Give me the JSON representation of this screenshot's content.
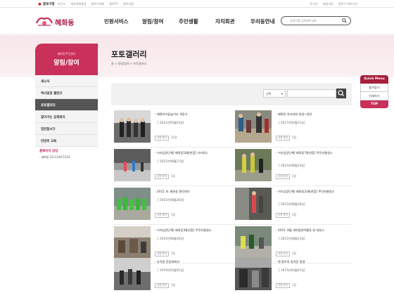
{
  "topbar": {
    "home": "종로구청",
    "links": [
      "보건소",
      "역사문화관광",
      "종로구의회",
      "종로TV",
      "종로사랑"
    ],
    "right": [
      "로그인",
      "회원가입",
      "종로구 바로가기"
    ]
  },
  "header": {
    "logo_text": "혜화동",
    "gnb": [
      "민원서비스",
      "알림/참여",
      "주민생활",
      "자치회관",
      "우리동안내"
    ],
    "search_placeholder": "검색어를 입력해주세요"
  },
  "sidebar": {
    "subtitle": "혜화동주민센터",
    "title": "알림/참여",
    "items": [
      {
        "label": "새소식"
      },
      {
        "label": "맥사일정 캘린더"
      },
      {
        "label": "포토갤러리"
      },
      {
        "label": "찾아가는 공제회의"
      },
      {
        "label": "칭찬합시다"
      },
      {
        "label": "민방위 교육"
      }
    ],
    "contact_title": "홈페이지 담당",
    "contact_detail": "- 혜화동 02-2148-5333"
  },
  "content": {
    "title": "포토갤러리",
    "breadcrumb": "홈 > 알림/참여 > 포토갤러리",
    "filter_select": "선택",
    "filter_arrow": "▾"
  },
  "gallery": [
    {
      "title": "- 혜명아이들놀이터 개장식",
      "date": "[ 2021년05월03일]",
      "badge": "사진 보기",
      "views": "12장"
    },
    {
      "title": "- 혜화동 척사대회 생생~현장",
      "date": "[ 2017년02월11일]",
      "badge": "사진 보기",
      "views": "1장"
    },
    {
      "title": "- 거리입양단체[ 혜화동18통연합] 거리청소",
      "date": "[ 2015년08월27일]",
      "badge": "사진 보기",
      "views": "1장"
    },
    {
      "title": "- 거리입양단체[ 혜화동7통연합] 주민자율청소",
      "date": "[ 2015년08월24일]",
      "badge": "사진 보기",
      "views": "1장"
    },
    {
      "title": "- 2015. 8. 혜화동 클린데이",
      "date": "[ 2015년08월26일]",
      "badge": "사진 보기",
      "views": "1장"
    },
    {
      "title": "- 거리입양단체[ 혜화동23통연합] 주민자율청소",
      "date": "[ 2015년08월26일]",
      "badge": "사진 보기",
      "views": "1장"
    },
    {
      "title": "- 거리입양단체[ 혜화동3통연합] 주민자율청소",
      "date": "[ 2015년08월26일]",
      "badge": "사진 보기",
      "views": "1장"
    },
    {
      "title": "- 2015. 8월 새마을방역활동 및 대청소",
      "date": "[ 2015년08월13일]",
      "badge": "사진 보기",
      "views": "1장"
    },
    {
      "title": "- 유치원 운동회에서",
      "date": "[ 1979년01월01일]",
      "badge": "사진 보기",
      "views": "1장"
    },
    {
      "title": "- 옛 종로의 정겨운 풍경",
      "date": "[ 1973년04월07일]",
      "badge": "사진 보기",
      "views": "1장"
    }
  ],
  "quick": {
    "head": "Quick Menu",
    "items": [
      "즐겨찾기",
      "인쇄하기"
    ],
    "top": "TOP"
  },
  "colors": {
    "brand": "#c9305a",
    "quick": "#a81e3e",
    "band": "#f7e6ea"
  }
}
